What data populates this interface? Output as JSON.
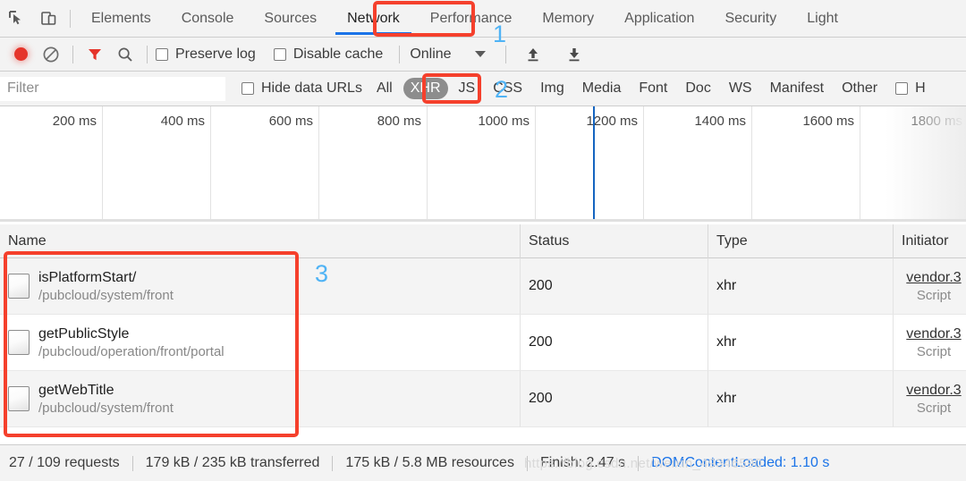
{
  "tabbar": {
    "inspect_icon": "inspect-cursor-icon",
    "device_icon": "device-toggle-icon",
    "tabs": [
      {
        "label": "Elements",
        "active": false
      },
      {
        "label": "Console",
        "active": false
      },
      {
        "label": "Sources",
        "active": false
      },
      {
        "label": "Network",
        "active": true
      },
      {
        "label": "Performance",
        "active": false
      },
      {
        "label": "Memory",
        "active": false
      },
      {
        "label": "Application",
        "active": false
      },
      {
        "label": "Security",
        "active": false
      },
      {
        "label": "Light",
        "active": false
      }
    ]
  },
  "toolbar": {
    "record_icon": "record-circle-icon",
    "clear_icon": "clear-prohibited-icon",
    "filter_icon": "filter-funnel-icon",
    "search_icon": "search-magnifier-icon",
    "preserve_log_label": "Preserve log",
    "disable_cache_label": "Disable cache",
    "throttle_value": "Online",
    "import_icon": "import-arrow-up-icon",
    "export_icon": "export-arrow-down-icon"
  },
  "filterbar": {
    "placeholder": "Filter",
    "value": "",
    "hide_data_urls_label": "Hide data URLs",
    "types": [
      {
        "label": "All",
        "selected": false
      },
      {
        "label": "XHR",
        "selected": true
      },
      {
        "label": "JS",
        "selected": false
      },
      {
        "label": "CSS",
        "selected": false
      },
      {
        "label": "Img",
        "selected": false
      },
      {
        "label": "Media",
        "selected": false
      },
      {
        "label": "Font",
        "selected": false
      },
      {
        "label": "Doc",
        "selected": false
      },
      {
        "label": "WS",
        "selected": false
      },
      {
        "label": "Manifest",
        "selected": false
      },
      {
        "label": "Other",
        "selected": false
      }
    ],
    "has_blocked_cookies_label": "H"
  },
  "overview": {
    "ticks": [
      "200 ms",
      "400 ms",
      "600 ms",
      "800 ms",
      "1000 ms",
      "1200 ms",
      "1400 ms",
      "1600 ms",
      "1800 ms"
    ],
    "dom_content_loaded_ms": 1200
  },
  "table": {
    "columns": [
      "Name",
      "Status",
      "Type",
      "Initiator"
    ],
    "rows": [
      {
        "name": "isPlatformStart/",
        "path": "/pubcloud/system/front",
        "status": "200",
        "type": "xhr",
        "initiator": "vendor.3",
        "initiator_sub": "Script"
      },
      {
        "name": "getPublicStyle",
        "path": "/pubcloud/operation/front/portal",
        "status": "200",
        "type": "xhr",
        "initiator": "vendor.3",
        "initiator_sub": "Script"
      },
      {
        "name": "getWebTitle",
        "path": "/pubcloud/system/front",
        "status": "200",
        "type": "xhr",
        "initiator": "vendor.3",
        "initiator_sub": "Script"
      }
    ]
  },
  "statusbar": {
    "requests": "27 / 109 requests",
    "transferred": "179 kB / 235 kB transferred",
    "resources": "175 kB / 5.8 MB resources",
    "finish": "Finish: 2.47 s",
    "dom_content_loaded": "DOMContentLoaded: 1.10 s",
    "watermark": "https://blog.csdn.net/weixin_49346590"
  },
  "annotations": {
    "marker_1": "1",
    "marker_2": "2",
    "marker_3": "3",
    "color": "#f5402c",
    "number_color": "#4fb3f5"
  }
}
